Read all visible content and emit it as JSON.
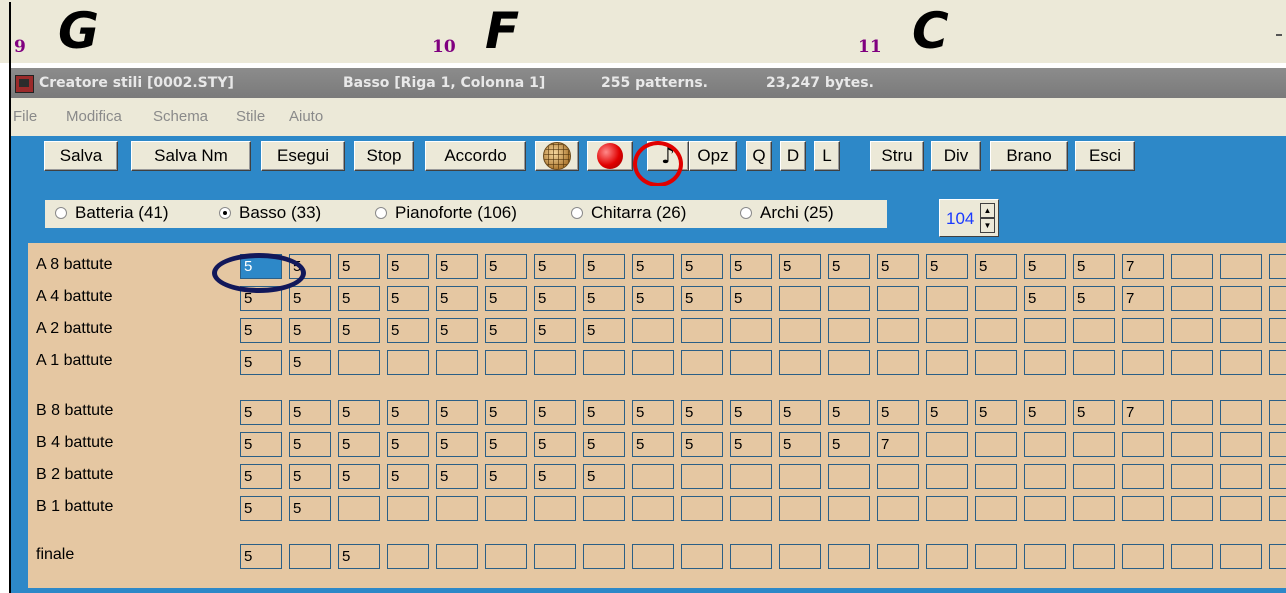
{
  "measures": [
    {
      "number": "9",
      "chord": "G"
    },
    {
      "number": "10",
      "chord": "F"
    },
    {
      "number": "11",
      "chord": "C"
    }
  ],
  "title_bar": {
    "app_title": "Creatore stili [0002.STY]",
    "part_info": "Basso  [Riga 1, Colonna 1]",
    "patterns": "255 patterns.",
    "bytes": "23,247 bytes."
  },
  "menu": [
    "File",
    "Modifica",
    "Schema",
    "Stile",
    "Aiuto"
  ],
  "toolbar": {
    "salva": "Salva",
    "salva_nm": "Salva Nm",
    "esegui": "Esegui",
    "stop": "Stop",
    "accordo": "Accordo",
    "note_icon": "♪",
    "opz": "Opz",
    "q": "Q",
    "d": "D",
    "l": "L",
    "stru": "Stru",
    "div": "Div",
    "brano": "Brano",
    "esci": "Esci"
  },
  "instruments": [
    {
      "label": "Batteria (41)",
      "selected": false
    },
    {
      "label": "Basso (33)",
      "selected": true
    },
    {
      "label": "Pianoforte (106)",
      "selected": false
    },
    {
      "label": "Chitarra (26)",
      "selected": false
    },
    {
      "label": "Archi (25)",
      "selected": false
    }
  ],
  "tempo": "104",
  "grid": {
    "rows": [
      {
        "label": "A 8 battute",
        "cells": [
          "5",
          "5",
          "5",
          "5",
          "5",
          "5",
          "5",
          "5",
          "5",
          "5",
          "5",
          "5",
          "5",
          "5",
          "5",
          "5",
          "5",
          "5",
          "7",
          "",
          "",
          ""
        ]
      },
      {
        "label": "A 4 battute",
        "cells": [
          "5",
          "5",
          "5",
          "5",
          "5",
          "5",
          "5",
          "5",
          "5",
          "5",
          "5",
          "",
          "",
          "",
          "",
          "",
          "5",
          "5",
          "7",
          "",
          "",
          ""
        ]
      },
      {
        "label": "A 2 battute",
        "cells": [
          "5",
          "5",
          "5",
          "5",
          "5",
          "5",
          "5",
          "5",
          "",
          "",
          "",
          "",
          "",
          "",
          "",
          "",
          "",
          "",
          "",
          "",
          "",
          ""
        ]
      },
      {
        "label": "A 1 battute",
        "cells": [
          "5",
          "5",
          "",
          "",
          "",
          "",
          "",
          "",
          "",
          "",
          "",
          "",
          "",
          "",
          "",
          "",
          "",
          "",
          "",
          "",
          "",
          ""
        ]
      },
      {
        "label": "B 8 battute",
        "cells": [
          "5",
          "5",
          "5",
          "5",
          "5",
          "5",
          "5",
          "5",
          "5",
          "5",
          "5",
          "5",
          "5",
          "5",
          "5",
          "5",
          "5",
          "5",
          "7",
          "",
          "",
          ""
        ]
      },
      {
        "label": "B 4 battute",
        "cells": [
          "5",
          "5",
          "5",
          "5",
          "5",
          "5",
          "5",
          "5",
          "5",
          "5",
          "5",
          "5",
          "5",
          "7",
          "",
          "",
          "",
          "",
          "",
          "",
          "",
          ""
        ]
      },
      {
        "label": "B 2 battute",
        "cells": [
          "5",
          "5",
          "5",
          "5",
          "5",
          "5",
          "5",
          "5",
          "",
          "",
          "",
          "",
          "",
          "",
          "",
          "",
          "",
          "",
          "",
          "",
          "",
          ""
        ]
      },
      {
        "label": "B 1 battute",
        "cells": [
          "5",
          "5",
          "",
          "",
          "",
          "",
          "",
          "",
          "",
          "",
          "",
          "",
          "",
          "",
          "",
          "",
          "",
          "",
          "",
          "",
          "",
          ""
        ]
      },
      {
        "label": "finale",
        "cells": [
          "5",
          "",
          "5",
          "",
          "",
          "",
          "",
          "",
          "",
          "",
          "",
          "",
          "",
          "",
          "",
          "",
          "",
          "",
          "",
          "",
          "",
          ""
        ]
      }
    ],
    "selected_cell": "A 8 battute, colonna 1"
  },
  "colors": {
    "toolbar_bg": "#2d88c8",
    "grid_bg": "#e5c7a2",
    "measure_number": "#800080",
    "highlight_circle": "#e00000",
    "highlight_oval": "#12185a"
  }
}
